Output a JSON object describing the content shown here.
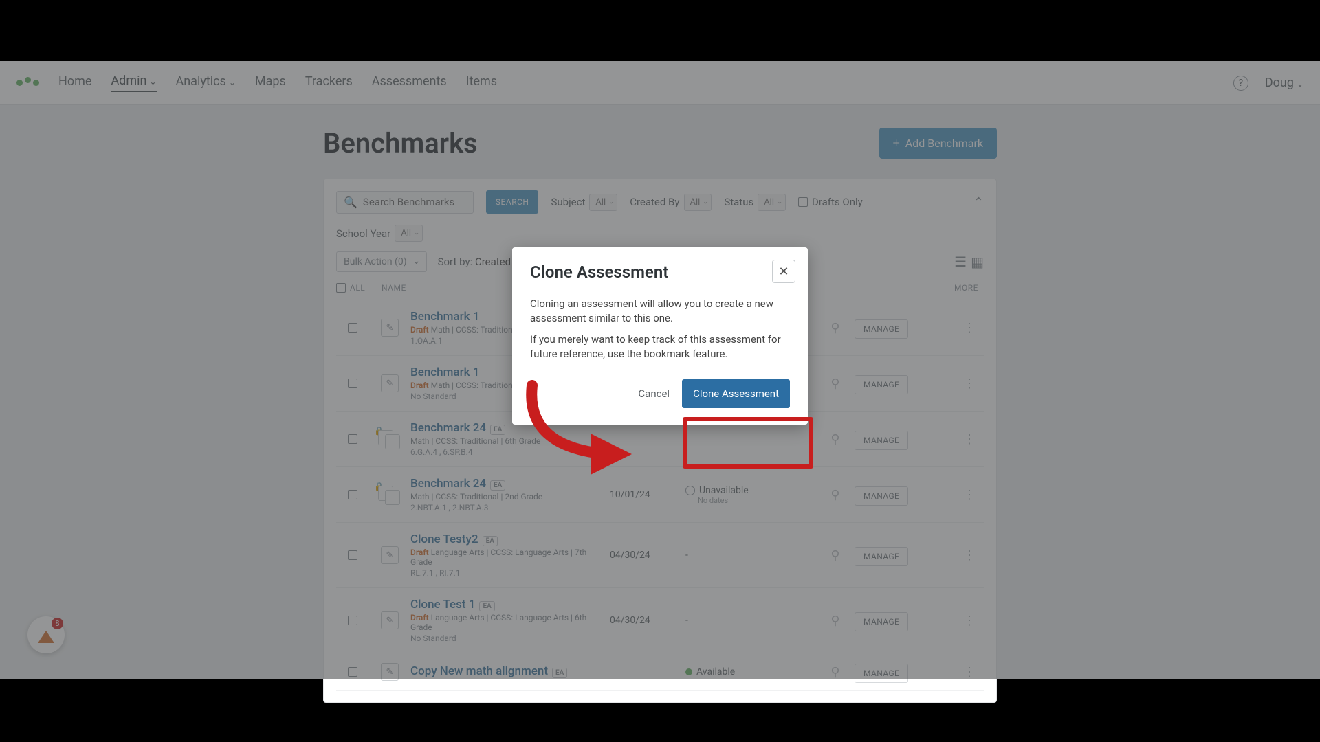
{
  "nav": {
    "items": [
      "Home",
      "Admin",
      "Analytics",
      "Maps",
      "Trackers",
      "Assessments",
      "Items"
    ],
    "active": "Admin",
    "user": "Doug"
  },
  "page": {
    "title": "Benchmarks",
    "add_button": "Add Benchmark"
  },
  "filters": {
    "search_placeholder": "Search Benchmarks",
    "search_button": "SEARCH",
    "subject_label": "Subject",
    "subject_value": "All",
    "createdby_label": "Created By",
    "createdby_value": "All",
    "status_label": "Status",
    "status_value": "All",
    "drafts_label": "Drafts Only",
    "schoolyear_label": "School Year",
    "schoolyear_value": "All"
  },
  "listhead": {
    "bulk": "Bulk Action (0)",
    "sort_prefix": "Sort by:",
    "sort_value": "Created (Most Recent)",
    "cols": {
      "all": "ALL",
      "name": "NAME",
      "more": "MORE"
    }
  },
  "rows": [
    {
      "name": "Benchmark 1",
      "draft": true,
      "meta": "Math  |  CCSS: Traditional",
      "standards": "1.OA.A.1",
      "date": "",
      "status": "",
      "status_sub": "",
      "ea": false,
      "stacked": false,
      "lock": false
    },
    {
      "name": "Benchmark 1",
      "draft": true,
      "meta": "Math  |  CCSS: Traditional",
      "standards": "No Standard",
      "date": "",
      "status": "",
      "status_sub": "",
      "ea": false,
      "stacked": false,
      "lock": false
    },
    {
      "name": "Benchmark 24",
      "draft": false,
      "meta": "Math  |  CCSS: Traditional  |  6th Grade",
      "standards": "6.G.A.4 , 6.SP.B.4",
      "date": "",
      "status": "",
      "status_sub": "",
      "ea": true,
      "stacked": true,
      "lock": true
    },
    {
      "name": "Benchmark 24",
      "draft": false,
      "meta": "Math  |  CCSS: Traditional  |  2nd Grade",
      "standards": "2.NBT.A.1 , 2.NBT.A.3",
      "date": "10/01/24",
      "status": "Unavailable",
      "status_sub": "No dates",
      "ea": true,
      "stacked": true,
      "lock": true
    },
    {
      "name": "Clone Testy2",
      "draft": true,
      "meta": "Language Arts  |  CCSS: Language Arts  |  7th Grade",
      "standards": "RL.7.1 , RI.7.1",
      "date": "04/30/24",
      "status": "-",
      "status_sub": "",
      "ea": true,
      "stacked": false,
      "lock": false
    },
    {
      "name": "Clone Test 1",
      "draft": true,
      "meta": "Language Arts  |  CCSS: Language Arts  |  6th Grade",
      "standards": "No Standard",
      "date": "04/30/24",
      "status": "-",
      "status_sub": "",
      "ea": true,
      "stacked": false,
      "lock": false
    },
    {
      "name": "Copy New math alignment",
      "draft": false,
      "meta": "",
      "standards": "",
      "date": "",
      "status": "Available",
      "status_sub": "",
      "ea": true,
      "stacked": false,
      "lock": true
    }
  ],
  "manage_label": "MANAGE",
  "modal": {
    "title": "Clone Assessment",
    "body1": "Cloning an assessment will allow you to create a new assessment similar to this one.",
    "body2": "If you merely want to keep track of this assessment for future reference, use the bookmark feature.",
    "cancel": "Cancel",
    "confirm": "Clone Assessment"
  },
  "fab_badge": "8"
}
